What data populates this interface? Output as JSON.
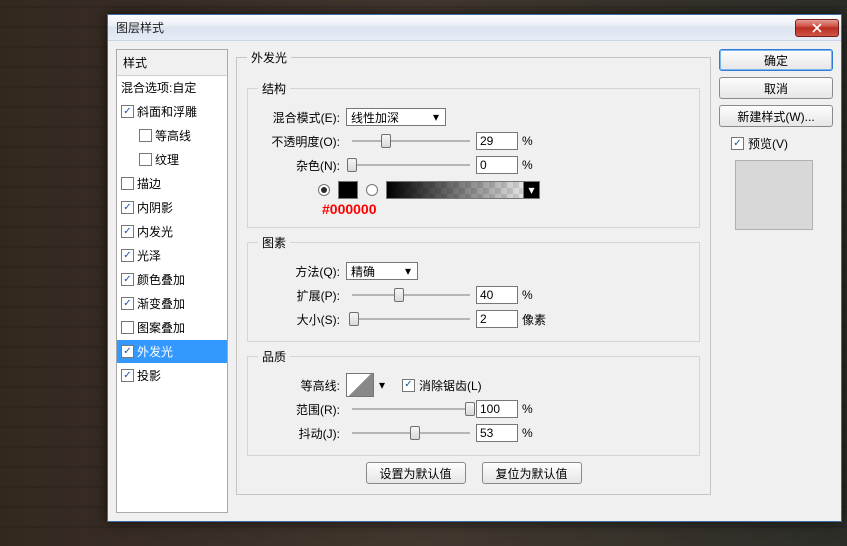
{
  "window": {
    "title": "图层样式"
  },
  "left": {
    "header": "样式",
    "blend": "混合选项:自定",
    "items": [
      {
        "label": "斜面和浮雕",
        "checked": true
      },
      {
        "label": "等高线",
        "checked": false,
        "sub": true
      },
      {
        "label": "纹理",
        "checked": false,
        "sub": true
      },
      {
        "label": "描边",
        "checked": false
      },
      {
        "label": "内阴影",
        "checked": true
      },
      {
        "label": "内发光",
        "checked": true
      },
      {
        "label": "光泽",
        "checked": true
      },
      {
        "label": "颜色叠加",
        "checked": true
      },
      {
        "label": "渐变叠加",
        "checked": true
      },
      {
        "label": "图案叠加",
        "checked": false
      },
      {
        "label": "外发光",
        "checked": true,
        "selected": true
      },
      {
        "label": "投影",
        "checked": true
      }
    ]
  },
  "panel": {
    "title": "外发光",
    "structure": {
      "legend": "结构",
      "blend_label": "混合模式(E):",
      "blend_value": "线性加深",
      "opacity_label": "不透明度(O):",
      "opacity_value": "29",
      "opacity_unit": "%",
      "noise_label": "杂色(N):",
      "noise_value": "0",
      "noise_unit": "%",
      "annotation": "#000000"
    },
    "element": {
      "legend": "图素",
      "method_label": "方法(Q):",
      "method_value": "精确",
      "spread_label": "扩展(P):",
      "spread_value": "40",
      "spread_unit": "%",
      "size_label": "大小(S):",
      "size_value": "2",
      "size_unit": "像素"
    },
    "quality": {
      "legend": "品质",
      "contour_label": "等高线:",
      "antialias_label": "消除锯齿(L)",
      "antialias_checked": true,
      "range_label": "范围(R):",
      "range_value": "100",
      "range_unit": "%",
      "jitter_label": "抖动(J):",
      "jitter_value": "53",
      "jitter_unit": "%"
    },
    "buttons": {
      "default": "设置为默认值",
      "reset": "复位为默认值"
    }
  },
  "right": {
    "ok": "确定",
    "cancel": "取消",
    "newstyle": "新建样式(W)...",
    "preview_label": "预览(V)",
    "preview_checked": true
  },
  "chart_data": {
    "type": "table",
    "title": "外发光 settings",
    "rows": [
      {
        "param": "混合模式",
        "value": "线性加深"
      },
      {
        "param": "不透明度",
        "value": 29,
        "unit": "%"
      },
      {
        "param": "杂色",
        "value": 0,
        "unit": "%"
      },
      {
        "param": "颜色",
        "value": "#000000"
      },
      {
        "param": "方法",
        "value": "精确"
      },
      {
        "param": "扩展",
        "value": 40,
        "unit": "%"
      },
      {
        "param": "大小",
        "value": 2,
        "unit": "像素"
      },
      {
        "param": "消除锯齿",
        "value": true
      },
      {
        "param": "范围",
        "value": 100,
        "unit": "%"
      },
      {
        "param": "抖动",
        "value": 53,
        "unit": "%"
      }
    ]
  }
}
